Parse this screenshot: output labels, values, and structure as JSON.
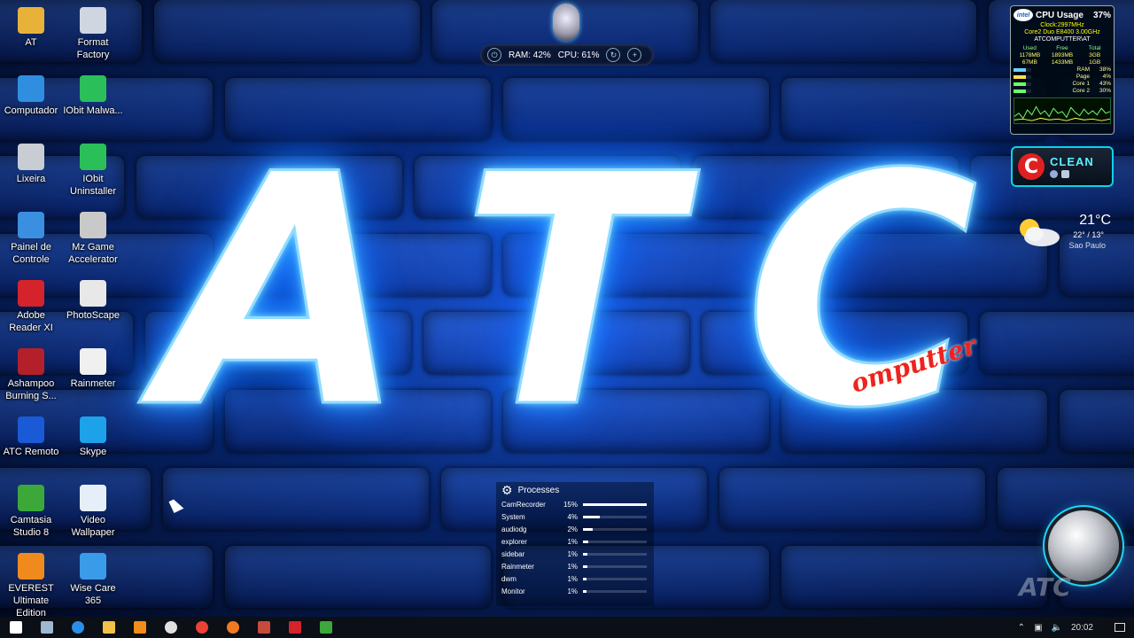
{
  "desktop_icons": [
    {
      "label": "AT",
      "icon": "user-folder-icon",
      "color": "#e8b23a"
    },
    {
      "label": "Format Factory",
      "icon": "format-factory-icon",
      "color": "#cfd6e0"
    },
    {
      "label": "Computador",
      "icon": "computer-icon",
      "color": "#2f8ee0"
    },
    {
      "label": "IObit Malwa...",
      "icon": "iobit-malware-icon",
      "color": "#2bbf5a"
    },
    {
      "label": "Lixeira",
      "icon": "recycle-bin-icon",
      "color": "#c8ccd3"
    },
    {
      "label": "IObit Uninstaller",
      "icon": "iobit-uninstaller-icon",
      "color": "#2bbf5a"
    },
    {
      "label": "Painel de Controle",
      "icon": "control-panel-icon",
      "color": "#3a8fe0"
    },
    {
      "label": "Mz Game Accelerator",
      "icon": "game-accelerator-icon",
      "color": "#c9c9c9"
    },
    {
      "label": "Adobe Reader XI",
      "icon": "adobe-reader-icon",
      "color": "#d4232b"
    },
    {
      "label": "PhotoScape",
      "icon": "photoscape-icon",
      "color": "#e8e8e8"
    },
    {
      "label": "Ashampoo Burning S...",
      "icon": "ashampoo-icon",
      "color": "#b3202a"
    },
    {
      "label": "Rainmeter",
      "icon": "rainmeter-icon",
      "color": "#f0f0f0"
    },
    {
      "label": "ATC Remoto",
      "icon": "atc-remote-icon",
      "color": "#1a5ad6"
    },
    {
      "label": "Skype",
      "icon": "skype-icon",
      "color": "#1da1e8"
    },
    {
      "label": "Camtasia Studio 8",
      "icon": "camtasia-icon",
      "color": "#3ca83a"
    },
    {
      "label": "Video Wallpaper",
      "icon": "video-wallpaper-icon",
      "color": "#e6eef7"
    },
    {
      "label": "EVEREST Ultimate Edition",
      "icon": "everest-icon",
      "color": "#f08a1c"
    },
    {
      "label": "Wise Care 365",
      "icon": "wise-care-icon",
      "color": "#3a9be8"
    }
  ],
  "wallpaper": {
    "letters": [
      "A",
      "T",
      "C"
    ],
    "subtitle": "omputter"
  },
  "sysbar": {
    "ram": "RAM: 42%",
    "cpu": "CPU: 61%"
  },
  "cpu_gadget": {
    "title": "CPU Usage",
    "percent": "37%",
    "brand": "intel",
    "clock": "Clock:2997MHz",
    "model": "Core2 Duo E8400 3.00GHz",
    "host": "ATCOMPUTTER\\AT",
    "mem_headers": [
      "Used",
      "Free",
      "Total"
    ],
    "mem_rows": [
      [
        "1178MB",
        "1893MB",
        "3GB"
      ],
      [
        "67MB",
        "1433MB",
        "1GB"
      ]
    ],
    "gauges": [
      {
        "label": "RAM",
        "value": "38%",
        "fill": 0.38,
        "color": "#6ad0ff"
      },
      {
        "label": "Page",
        "value": "4%",
        "fill": 0.04,
        "color": "#ffe14a"
      },
      {
        "label": "Core 1",
        "value": "43%",
        "fill": 0.43,
        "color": "#6cff6c"
      },
      {
        "label": "Core 2",
        "value": "30%",
        "fill": 0.3,
        "color": "#6cff6c"
      }
    ]
  },
  "cleaner": {
    "label": "CLEAN"
  },
  "weather": {
    "temp": "21°C",
    "range": "22° / 13°",
    "city": "Sao Paulo"
  },
  "processes": {
    "title": "Processes",
    "rows": [
      {
        "name": "CamRecorder",
        "pct": "15%",
        "fill": 1.0
      },
      {
        "name": "System",
        "pct": "4%",
        "fill": 0.27
      },
      {
        "name": "audiodg",
        "pct": "2%",
        "fill": 0.15
      },
      {
        "name": "explorer",
        "pct": "1%",
        "fill": 0.08
      },
      {
        "name": "sidebar",
        "pct": "1%",
        "fill": 0.07
      },
      {
        "name": "Rainmeter",
        "pct": "1%",
        "fill": 0.07
      },
      {
        "name": "dwm",
        "pct": "1%",
        "fill": 0.06
      },
      {
        "name": "Monitor",
        "pct": "1%",
        "fill": 0.05
      }
    ]
  },
  "knob_text": "ATC",
  "taskbar": {
    "apps": [
      {
        "name": "start-button",
        "icon": "windows-icon",
        "color": "#ffffff"
      },
      {
        "name": "taskbar-app-computer",
        "icon": "computer-icon",
        "color": "#9fb7cf"
      },
      {
        "name": "taskbar-app-edge",
        "icon": "edge-icon",
        "color": "#2d8ee6"
      },
      {
        "name": "taskbar-app-explorer",
        "icon": "folder-icon",
        "color": "#f2c14a"
      },
      {
        "name": "taskbar-app-media",
        "icon": "media-player-icon",
        "color": "#f28c1a"
      },
      {
        "name": "taskbar-app-settings",
        "icon": "gear-icon",
        "color": "#e0e0e0"
      },
      {
        "name": "taskbar-app-chrome",
        "icon": "chrome-icon",
        "color": "#e94335"
      },
      {
        "name": "taskbar-app-firefox",
        "icon": "firefox-icon",
        "color": "#f07a22"
      },
      {
        "name": "taskbar-app-installer",
        "icon": "installer-icon",
        "color": "#c64b3d"
      },
      {
        "name": "taskbar-app-pdf",
        "icon": "pdf-icon",
        "color": "#d4232b"
      },
      {
        "name": "taskbar-app-camtasia",
        "icon": "camtasia-icon",
        "color": "#3ca83a"
      }
    ],
    "clock": "20:02"
  }
}
